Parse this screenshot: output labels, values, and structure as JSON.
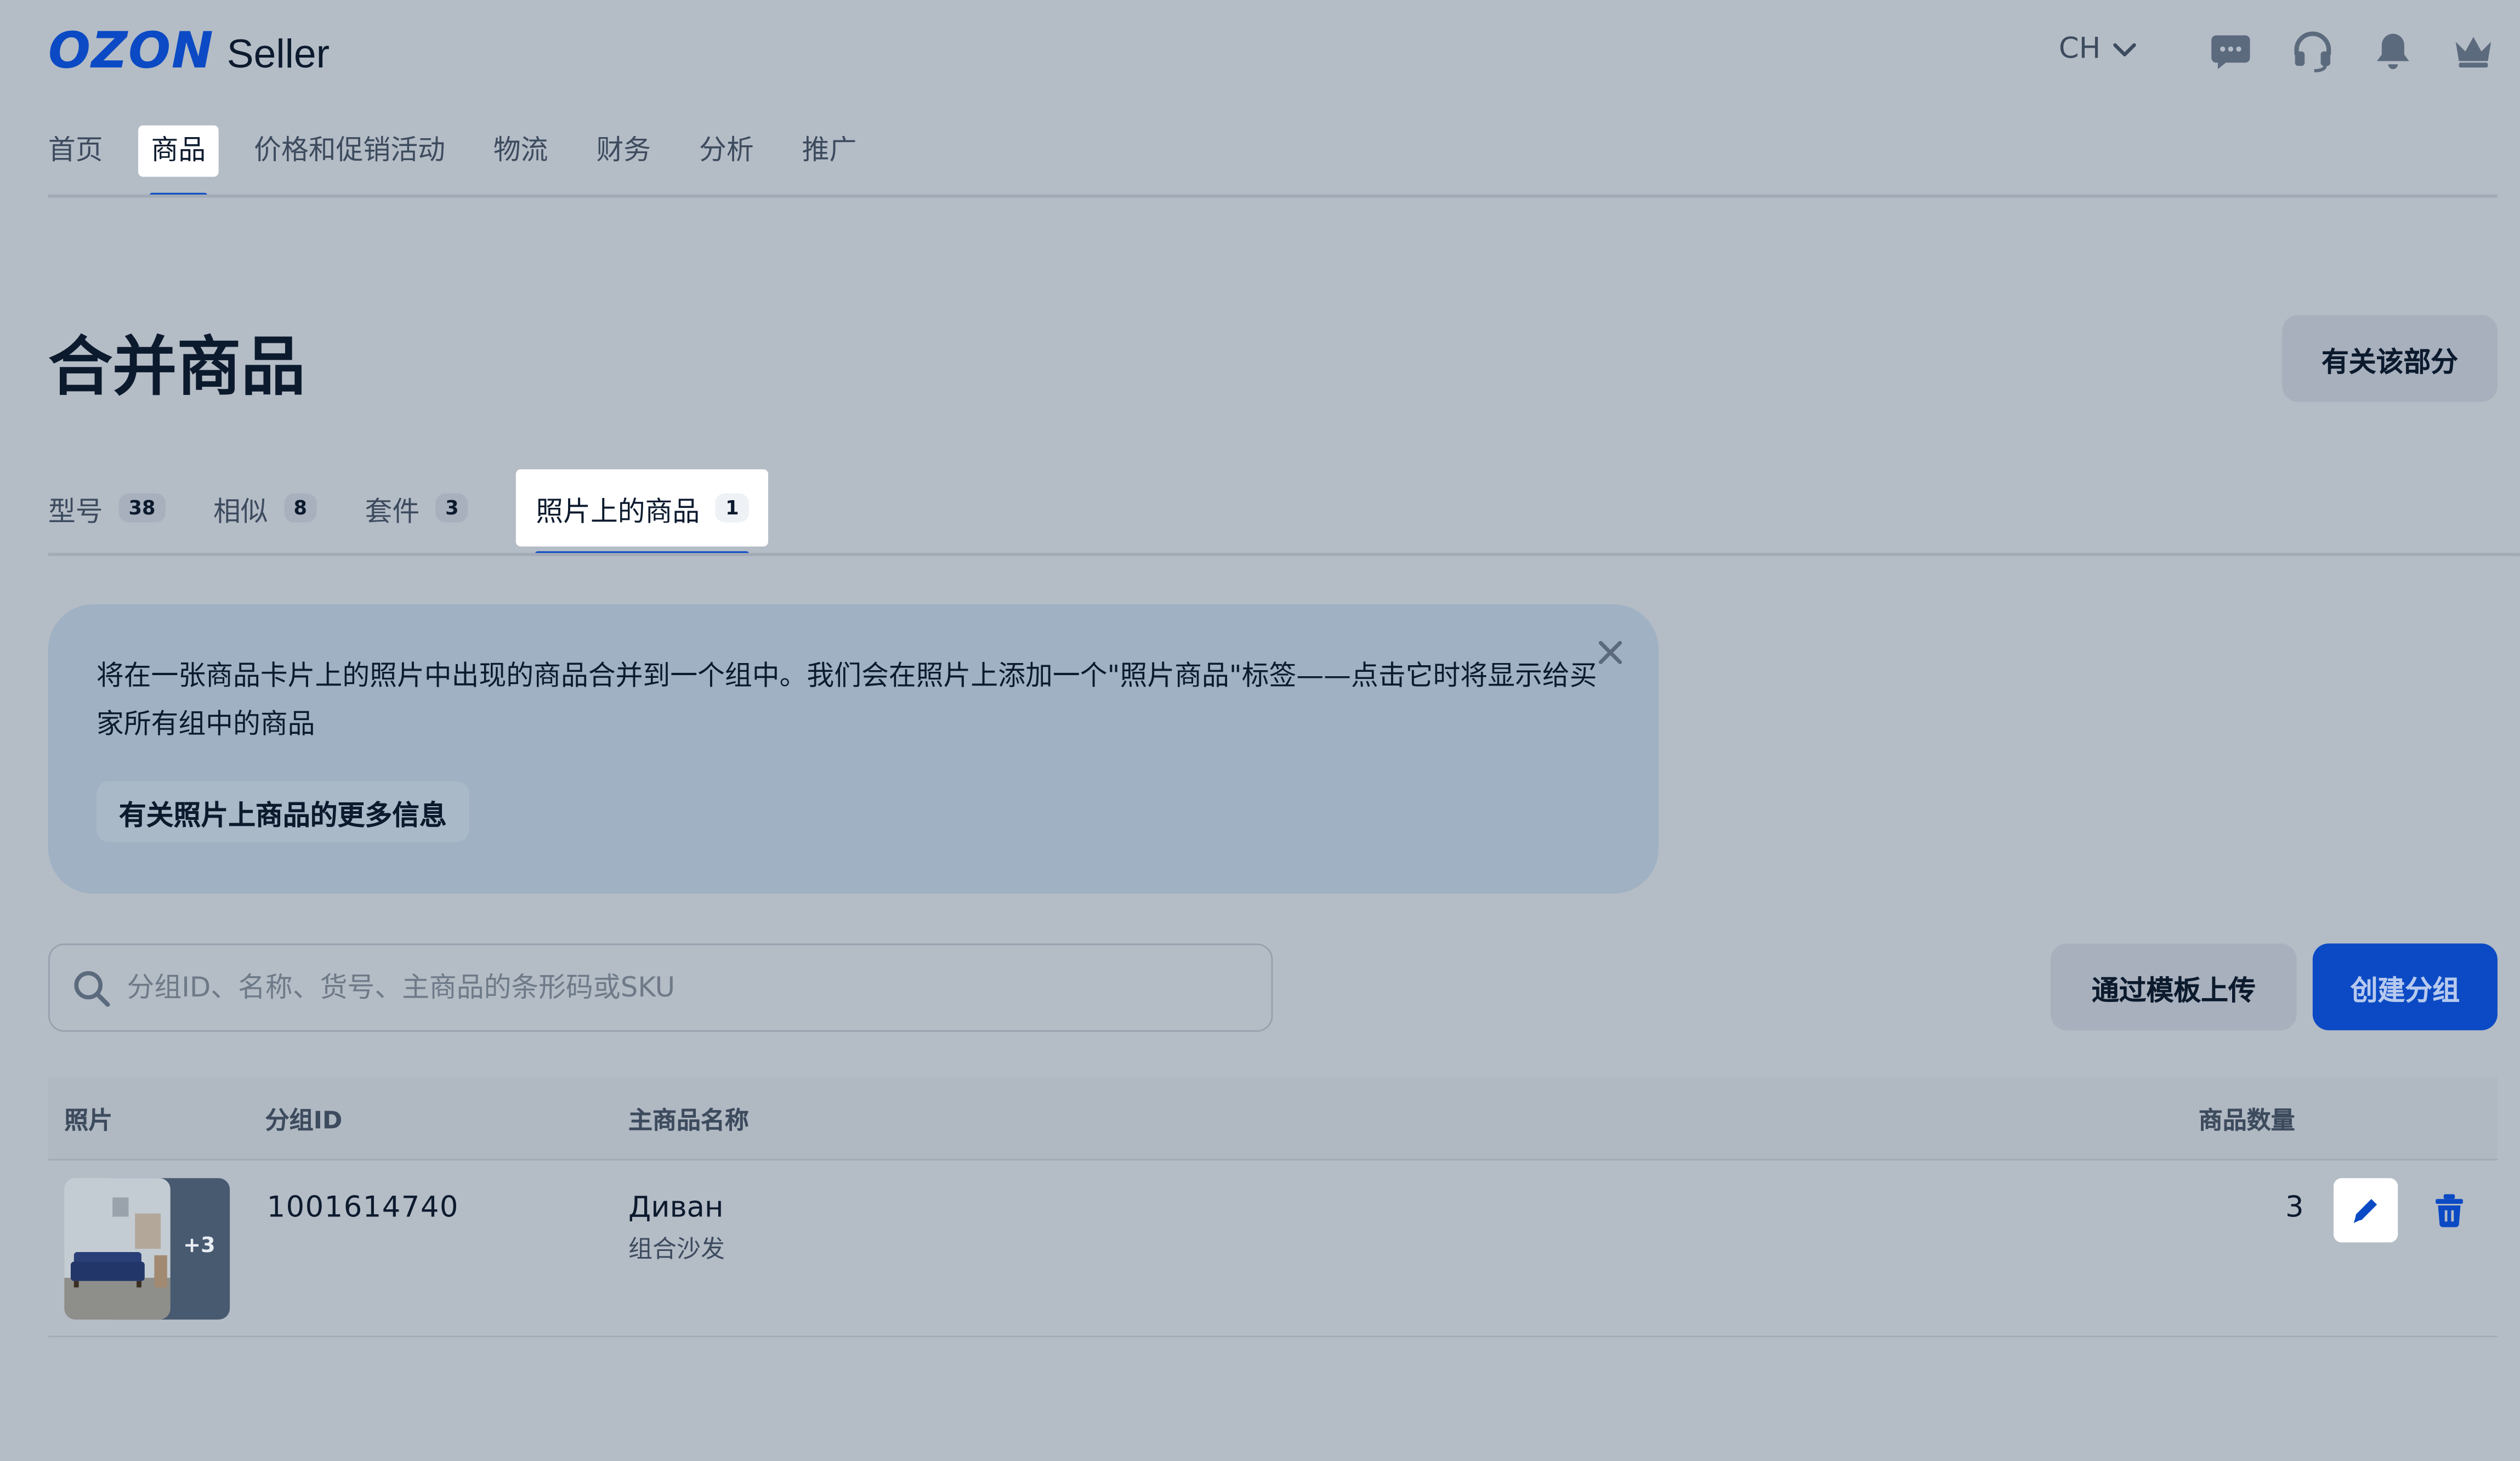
{
  "header": {
    "logo_brand": "OZON",
    "logo_suffix": "Seller",
    "language": "CH",
    "icons": [
      "chat-icon",
      "headset-icon",
      "bell-icon",
      "crown-icon"
    ]
  },
  "nav": {
    "items": [
      {
        "label": "首页",
        "active": false
      },
      {
        "label": "商品",
        "active": true
      },
      {
        "label": "价格和促销活动",
        "active": false
      },
      {
        "label": "物流",
        "active": false
      },
      {
        "label": "财务",
        "active": false
      },
      {
        "label": "分析",
        "active": false
      },
      {
        "label": "推广",
        "active": false
      }
    ]
  },
  "page": {
    "title": "合并商品",
    "about_button": "有关该部分"
  },
  "tabs": [
    {
      "label": "型号",
      "count": "38",
      "active": false
    },
    {
      "label": "相似",
      "count": "8",
      "active": false
    },
    {
      "label": "套件",
      "count": "3",
      "active": false
    },
    {
      "label": "照片上的商品",
      "count": "1",
      "active": true
    }
  ],
  "info_panel": {
    "text": "将在一张商品卡片上的照片中出现的商品合并到一个组中。我们会在照片上添加一个\"照片商品\"标签——点击它时将显示给买家所有组中的商品",
    "link_label": "有关照片上商品的更多信息"
  },
  "search": {
    "placeholder": "分组ID、名称、货号、主商品的条形码或SKU",
    "value": ""
  },
  "actions": {
    "upload_template": "通过模板上传",
    "create_group": "创建分组"
  },
  "table": {
    "columns": [
      "照片",
      "分组ID",
      "主商品名称",
      "商品数量"
    ],
    "rows": [
      {
        "photo_extra": "+3",
        "group_id": "1001614740",
        "name": "Диван",
        "subname": "组合沙发",
        "count": "3"
      }
    ]
  },
  "colors": {
    "accent": "#0b4ac4",
    "background": "#b4bcc6",
    "info_panel": "#9fb1c3"
  }
}
